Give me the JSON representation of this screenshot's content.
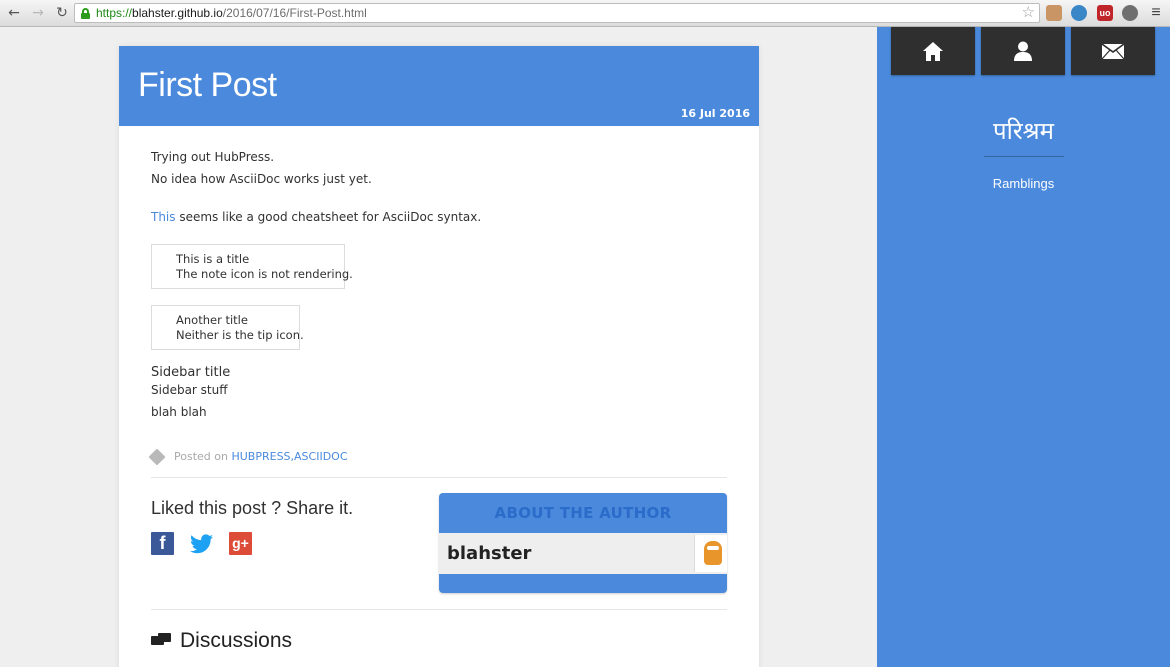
{
  "browser": {
    "url_scheme": "https://",
    "url_host": "blahster.github.io",
    "url_path": "/2016/07/16/First-Post.html",
    "back_glyph": "←",
    "forward_glyph": "→",
    "reload_glyph": "↻",
    "star_glyph": "☆",
    "menu_glyph": "≡",
    "ublock_label": "uo"
  },
  "post": {
    "title": "First Post",
    "date": "16 Jul 2016",
    "paragraph1": "Trying out HubPress.",
    "paragraph2": "No idea how AsciiDoc works just yet.",
    "link_text": "This",
    "paragraph3_rest": " seems like a good cheatsheet for AsciiDoc syntax.",
    "admonitions": [
      {
        "title": "This is a title",
        "body": "The note icon is not rendering."
      },
      {
        "title": "Another title",
        "body": "Neither is the tip icon."
      }
    ],
    "sidebar_block": {
      "title": "Sidebar title",
      "body": "Sidebar stuff"
    },
    "trailing_text": "blah blah",
    "posted_on_label": "Posted on",
    "tags": [
      "HUBPRESS",
      "ASCIIDOC"
    ],
    "tag_separator": ", ",
    "share_title": "Liked this post ? Share it.",
    "share_buttons": {
      "facebook": "f",
      "twitter": "🐦",
      "googleplus": "g+"
    },
    "author_heading": "ABOUT THE AUTHOR",
    "author_name": "blahster",
    "discussions_title": "Discussions"
  },
  "sidebar": {
    "site_title": "परिश्रम",
    "site_description": "Ramblings"
  },
  "colors": {
    "accent": "#4a89dc",
    "nav_button": "#2f2f2f"
  }
}
